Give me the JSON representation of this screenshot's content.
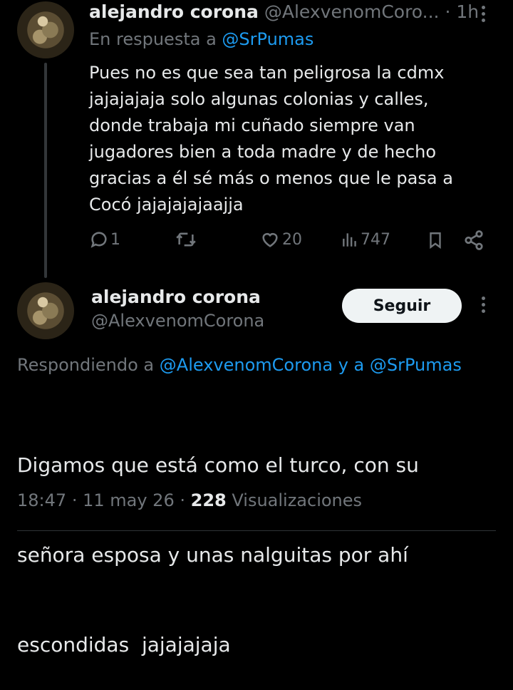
{
  "reply": {
    "author_name": "alejandro corona",
    "author_handle": "@AlexvenomCoro...",
    "time": "· 1h",
    "replying_prefix": "En respuesta a",
    "replying_to": "@SrPumas",
    "text_lines": [
      "Pues no es que sea tan peligrosa la cdmx",
      "jajajajaja solo algunas colonias y calles,",
      "donde trabaja mi cuñado siempre van",
      "jugadores bien a toda madre y de hecho",
      "gracias a él sé más o menos que le pasa a",
      "Cocó jajajajajaajja"
    ],
    "actions": {
      "reply_count": "1",
      "retweet_count": "",
      "like_count": "20",
      "views_count": "747"
    }
  },
  "main": {
    "author_name": "alejandro corona",
    "author_handle": "@AlexvenomCorona",
    "follow_label": "Seguir",
    "replying_prefix": "Respondiendo a",
    "replying_to_1": "@AlexvenomCorona",
    "replying_joiner": "y a",
    "replying_to_2": "@SrPumas",
    "text_lines": [
      "Digamos que está como el turco, con su",
      "señora esposa y unas nalguitas por ahí",
      "escondidas  jajajajaja"
    ],
    "time": "18:47",
    "sep1": "·",
    "date": "11 may 26",
    "sep2": "·",
    "views_number": "228",
    "views_label": "Visualizaciones"
  },
  "icons": [
    "avatar",
    "more-icon",
    "reply-icon",
    "retweet-icon",
    "like-icon",
    "views-icon",
    "bookmark-icon",
    "share-icon"
  ]
}
